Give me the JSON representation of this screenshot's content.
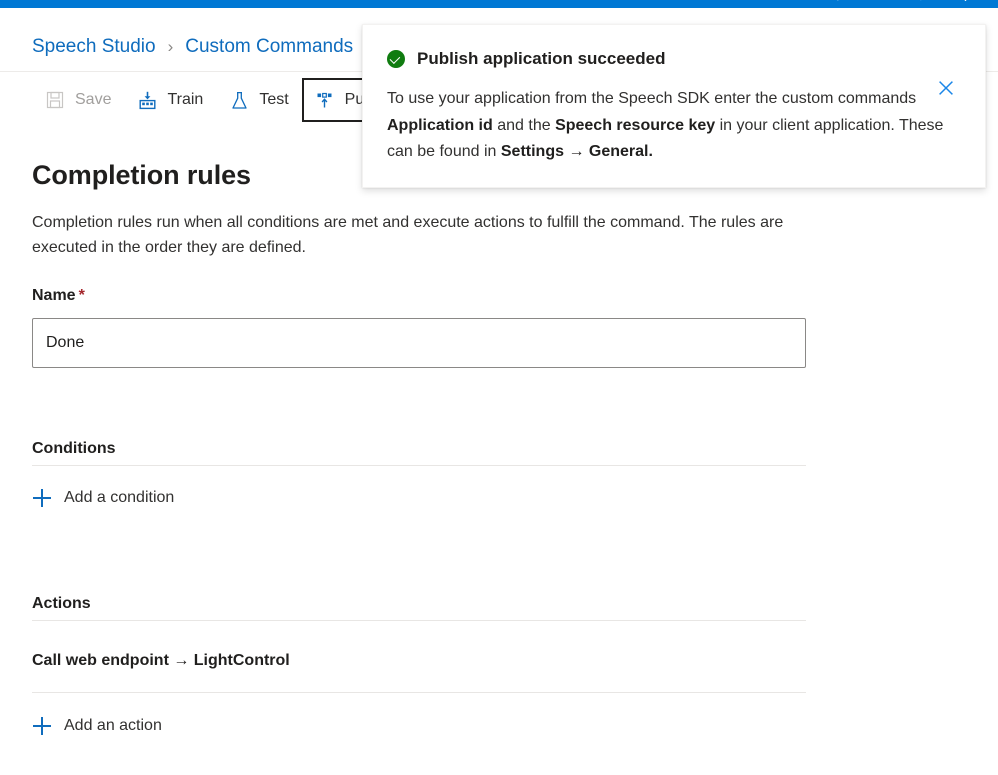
{
  "topbar": {
    "glyphs": "⚙ ? ☺ ⋮"
  },
  "breadcrumb": {
    "items": [
      {
        "label": "Speech Studio"
      },
      {
        "label": "Custom Commands"
      }
    ],
    "separator": "›"
  },
  "toolbar": {
    "save_label": "Save",
    "train_label": "Train",
    "test_label": "Test",
    "publish_label": "Pub"
  },
  "page": {
    "title": "Completion rules",
    "description": "Completion rules run when all conditions are met and execute actions to fulfill the command. The rules are executed in the order they are defined."
  },
  "name_field": {
    "label": "Name",
    "required_marker": "*",
    "value": "Done",
    "placeholder": ""
  },
  "conditions": {
    "heading": "Conditions",
    "add_label": "Add a condition"
  },
  "actions": {
    "heading": "Actions",
    "items": [
      {
        "label": "Call web endpoint → LightControl"
      }
    ],
    "add_label": "Add an action"
  },
  "notification": {
    "title": "Publish application succeeded",
    "body_parts": [
      {
        "text": "To use your application from the Speech SDK enter the custom commands ",
        "bold": false
      },
      {
        "text": "Application id",
        "bold": true
      },
      {
        "text": " and the ",
        "bold": false
      },
      {
        "text": "Speech resource key",
        "bold": true
      },
      {
        "text": " in your client application. These can be found in ",
        "bold": false
      },
      {
        "text": "Settings → General.",
        "bold": true
      }
    ],
    "close_label": "Close"
  },
  "colors": {
    "azure_blue": "#0078d4",
    "link_blue": "#0f6cbd",
    "success_green": "#107c10",
    "required_red": "#a4262c"
  }
}
